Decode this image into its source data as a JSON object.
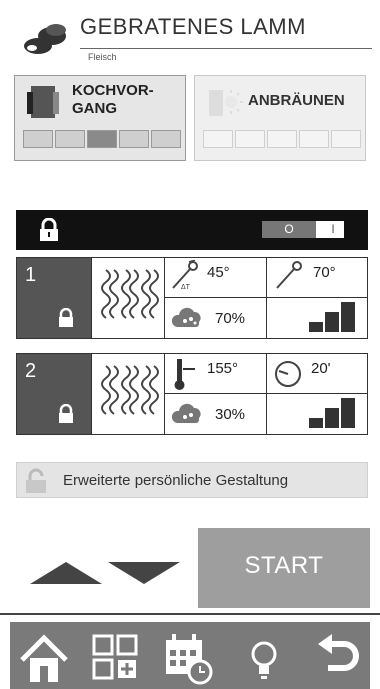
{
  "header": {
    "title": "GEBRATENES LAMM",
    "subtitle": "Fleisch"
  },
  "modes": [
    {
      "label": "KOCHVOR-\nGANG",
      "steps": 5,
      "active_step": 3,
      "selected": true
    },
    {
      "label": "ANBRÄUNEN",
      "steps": 5,
      "active_step": 0,
      "selected": false
    }
  ],
  "lock_bar": {
    "switch_off_label": "O",
    "switch_on_label": "I"
  },
  "phases": [
    {
      "number": "1",
      "core_delta_temp": "45°",
      "core_delta_sub": "ΔT",
      "core_temp": "70°",
      "humidity": "70%",
      "fan_level": 3
    },
    {
      "number": "2",
      "oven_temp": "155°",
      "time": "20'",
      "humidity": "30%",
      "fan_level": 3
    }
  ],
  "advanced": {
    "label": "Erweiterte persönliche Gestaltung"
  },
  "start_button": "START",
  "nav": {
    "items": [
      "home-icon",
      "add-program-icon",
      "calendar-schedule-icon",
      "tips-bulb-icon",
      "back-icon"
    ]
  }
}
